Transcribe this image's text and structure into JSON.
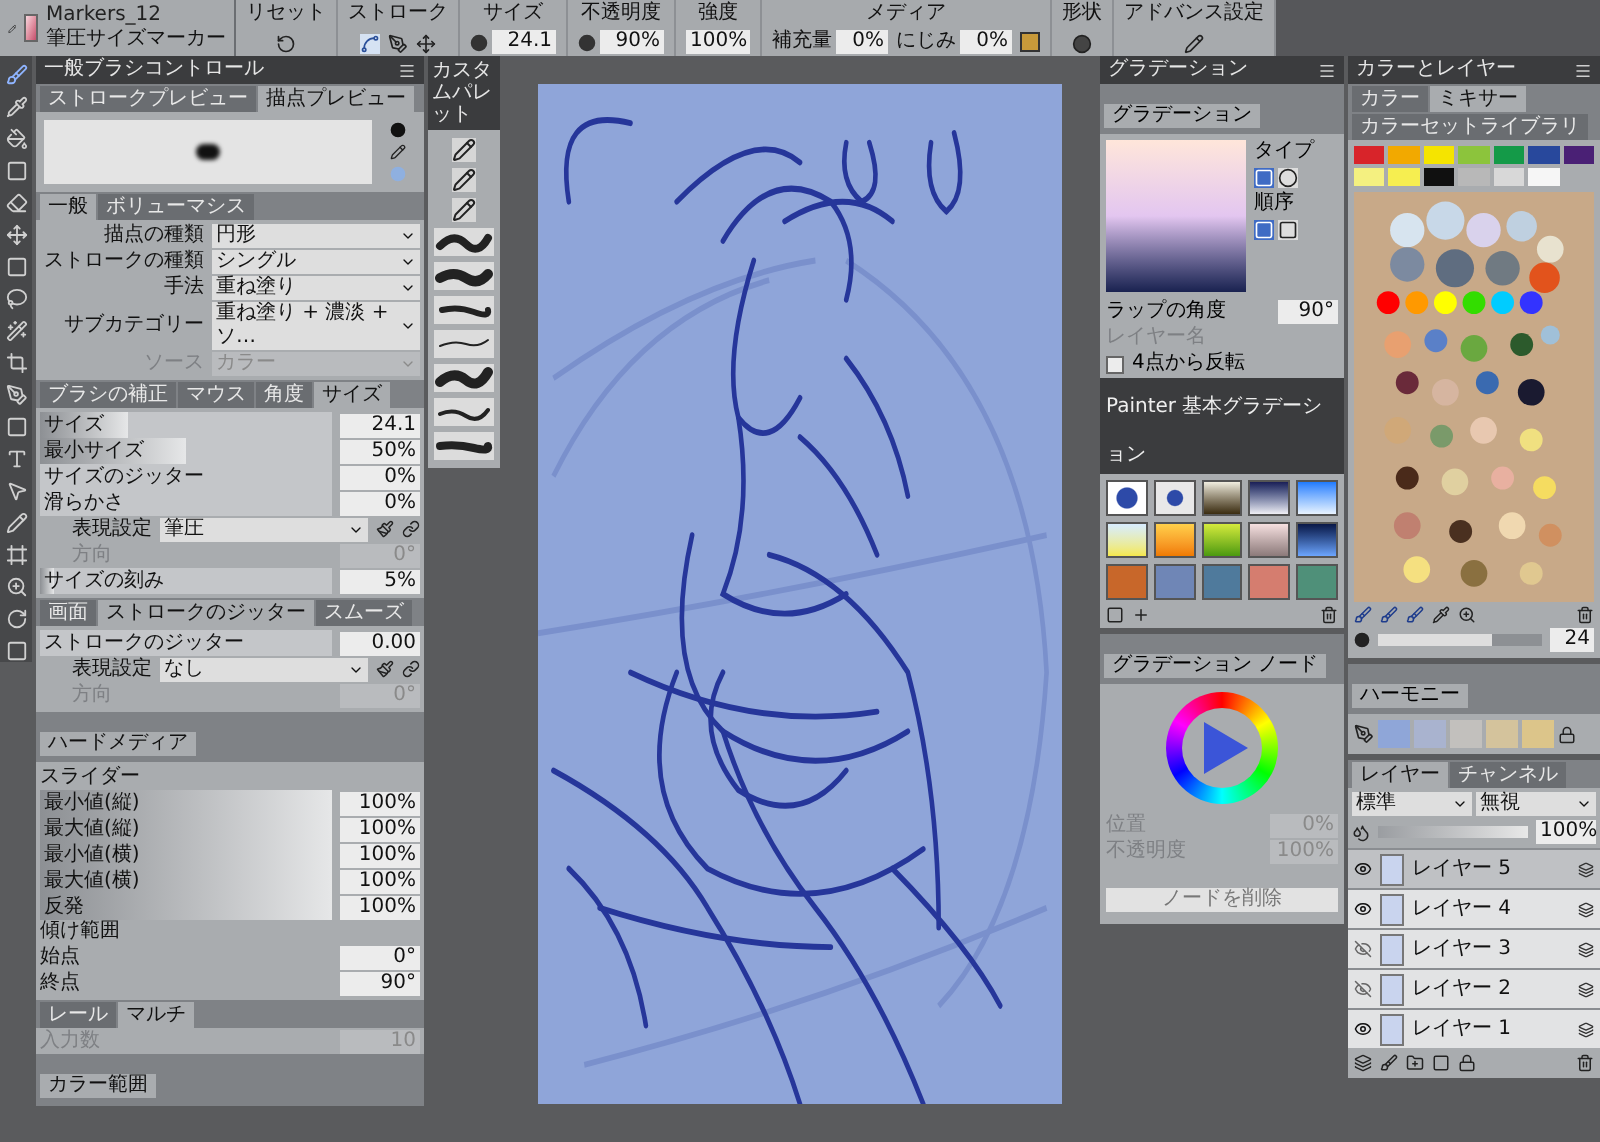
{
  "toolbar": {
    "brush_category": "Markers_12",
    "brush_variant": "筆圧サイズマーカー",
    "sections": [
      {
        "kind": "icon",
        "label": "リセット"
      },
      {
        "kind": "stroke",
        "label": "ストローク"
      },
      {
        "kind": "field",
        "label": "サイズ",
        "value": "24.1"
      },
      {
        "kind": "field",
        "label": "不透明度",
        "value": "90%"
      },
      {
        "kind": "plain",
        "label": "強度",
        "value": "100%"
      },
      {
        "kind": "media",
        "label": "メディア",
        "fields": [
          {
            "label": "補充量",
            "value": "0%"
          },
          {
            "label": "にじみ",
            "value": "0%"
          }
        ]
      },
      {
        "kind": "icon",
        "label": "形状"
      },
      {
        "kind": "icon",
        "label": "アドバンス設定"
      }
    ]
  },
  "brush_panel": {
    "title": "一般ブラシコントロール",
    "preview_tabs": [
      {
        "label": "ストロークプレビュー",
        "selected": false
      },
      {
        "label": "描点プレビュー",
        "selected": true
      }
    ],
    "general_tabs": [
      {
        "label": "一般",
        "selected": true
      },
      {
        "label": "ボリューマシス",
        "selected": false
      }
    ],
    "general_rows": [
      {
        "label": "描点の種類",
        "value": "円形",
        "disabled": false
      },
      {
        "label": "ストロークの種類",
        "value": "シングル",
        "disabled": false
      },
      {
        "label": "手法",
        "value": "重ね塗り",
        "disabled": false
      },
      {
        "label": "サブカテゴリー",
        "value": "重ね塗り + 濃淡 + ソ…",
        "disabled": false
      },
      {
        "label": "ソース",
        "value": "カラー",
        "disabled": true
      }
    ],
    "size_tabs": [
      {
        "label": "ブラシの補正",
        "selected": false
      },
      {
        "label": "マウス",
        "selected": false
      },
      {
        "label": "角度",
        "selected": false
      },
      {
        "label": "サイズ",
        "selected": true
      }
    ],
    "size_rows": [
      {
        "kind": "slider",
        "label": "サイズ",
        "level": 0.3,
        "value": "24.1"
      },
      {
        "kind": "slider",
        "label": "最小サイズ",
        "level": 0.5,
        "value": "50%"
      },
      {
        "kind": "slider",
        "label": "サイズのジッター",
        "level": 0,
        "value": "0%"
      },
      {
        "kind": "slider",
        "label": "滑らかさ",
        "level": 0,
        "value": "0%"
      },
      {
        "kind": "select",
        "label": "表現設定",
        "value": "筆圧"
      },
      {
        "kind": "field",
        "label": "方向",
        "value": "0°",
        "disabled": true
      },
      {
        "kind": "slider",
        "label": "サイズの刻み",
        "level": 0.05,
        "value": "5%"
      }
    ],
    "jitter_tabs": [
      {
        "label": "画面",
        "selected": false
      },
      {
        "label": "ストロークのジッター",
        "selected": true
      },
      {
        "label": "スムーズ",
        "selected": false
      }
    ],
    "jitter_rows": [
      {
        "kind": "slider",
        "label": "ストロークのジッター",
        "level": 0,
        "value": "0.00"
      },
      {
        "kind": "select",
        "label": "表現設定",
        "value": "なし"
      },
      {
        "kind": "field",
        "label": "方向",
        "value": "0°",
        "disabled": true
      }
    ],
    "hard_media": {
      "title": "ハードメディア",
      "slider_label": "スライダー",
      "rows": [
        {
          "label": "最小値(縦)",
          "level": 1,
          "value": "100%"
        },
        {
          "label": "最大値(縦)",
          "level": 1,
          "value": "100%"
        },
        {
          "label": "最小値(横)",
          "level": 1,
          "value": "100%"
        },
        {
          "label": "最大値(横)",
          "level": 1,
          "value": "100%"
        },
        {
          "label": "反発",
          "level": 1,
          "value": "100%"
        }
      ],
      "tilt_label": "傾け範囲",
      "tilt_rows": [
        {
          "label": "始点",
          "value": "0°"
        },
        {
          "label": "終点",
          "value": "90°"
        }
      ]
    },
    "multi_tabs": [
      {
        "label": "レール",
        "selected": false
      },
      {
        "label": "マルチ",
        "selected": true
      }
    ],
    "multi_row": {
      "label": "入力数",
      "value": "10",
      "disabled": true
    },
    "color_range_title": "カラー範囲"
  },
  "library_panel": {
    "title": "カスタムパレット"
  },
  "gradient_panel": {
    "title": "グラデーション",
    "tab": "グラデーション",
    "type_label": "タイプ",
    "order_label": "順序",
    "angle_label": "ラップの角度",
    "angle_value": "90°",
    "layer_label": "レイヤー名",
    "repeat": {
      "label": "4点から反転",
      "checked": false
    },
    "library_title": "Painter 基本グラデーション"
  },
  "node_panel": {
    "title": "グラデーション ノード",
    "rows": [
      {
        "label": "位置",
        "value": "0%"
      },
      {
        "label": "不透明度",
        "value": "100%"
      }
    ],
    "button": "ノードを削除"
  },
  "color_panel": {
    "title": "カラーとレイヤー",
    "tabs": [
      {
        "label": "カラー",
        "selected": false
      },
      {
        "label": "ミキサー",
        "selected": true
      },
      {
        "label": "カラーセットライブラリ",
        "selected": false
      }
    ],
    "swatches": [
      {
        "color": "#d8242a"
      },
      {
        "color": "#f2a900"
      },
      {
        "color": "#f5e400"
      },
      {
        "color": "#8cc43c"
      },
      {
        "color": "#149a48"
      },
      {
        "color": "#28489c"
      },
      {
        "color": "#4a2075"
      },
      {
        "color": "#f4f080"
      },
      {
        "color": "#f6ee50"
      },
      {
        "color": "#101010"
      },
      {
        "color": "#b8b8b8"
      },
      {
        "color": "#d8d8d8"
      },
      {
        "color": "#f6f6f6"
      }
    ],
    "size_value": "24",
    "size_slider": {
      "level": 0.7
    }
  },
  "harmony_panel": {
    "title": "ハーモニー",
    "swatches": [
      {
        "color": "#8fa6d8"
      },
      {
        "color": "#a9b3cf"
      },
      {
        "color": "#c2c0bd"
      },
      {
        "color": "#d4c39c"
      },
      {
        "color": "#dcc58a"
      }
    ]
  },
  "layers_panel": {
    "tabs": [
      {
        "label": "レイヤー",
        "selected": true
      },
      {
        "label": "チャンネル",
        "selected": false
      }
    ],
    "blend": "標準",
    "composite": "無視",
    "opacity": "100%",
    "opacity_slider": {
      "level": 1
    },
    "layers": [
      {
        "name": "レイヤー 5",
        "visible": true,
        "selected": true
      },
      {
        "name": "レイヤー 4",
        "visible": true,
        "selected": false
      },
      {
        "name": "レイヤー 3",
        "visible": false,
        "selected": false
      },
      {
        "name": "レイヤー 2",
        "visible": false,
        "selected": false
      },
      {
        "name": "レイヤー 1",
        "visible": true,
        "selected": false
      }
    ]
  }
}
